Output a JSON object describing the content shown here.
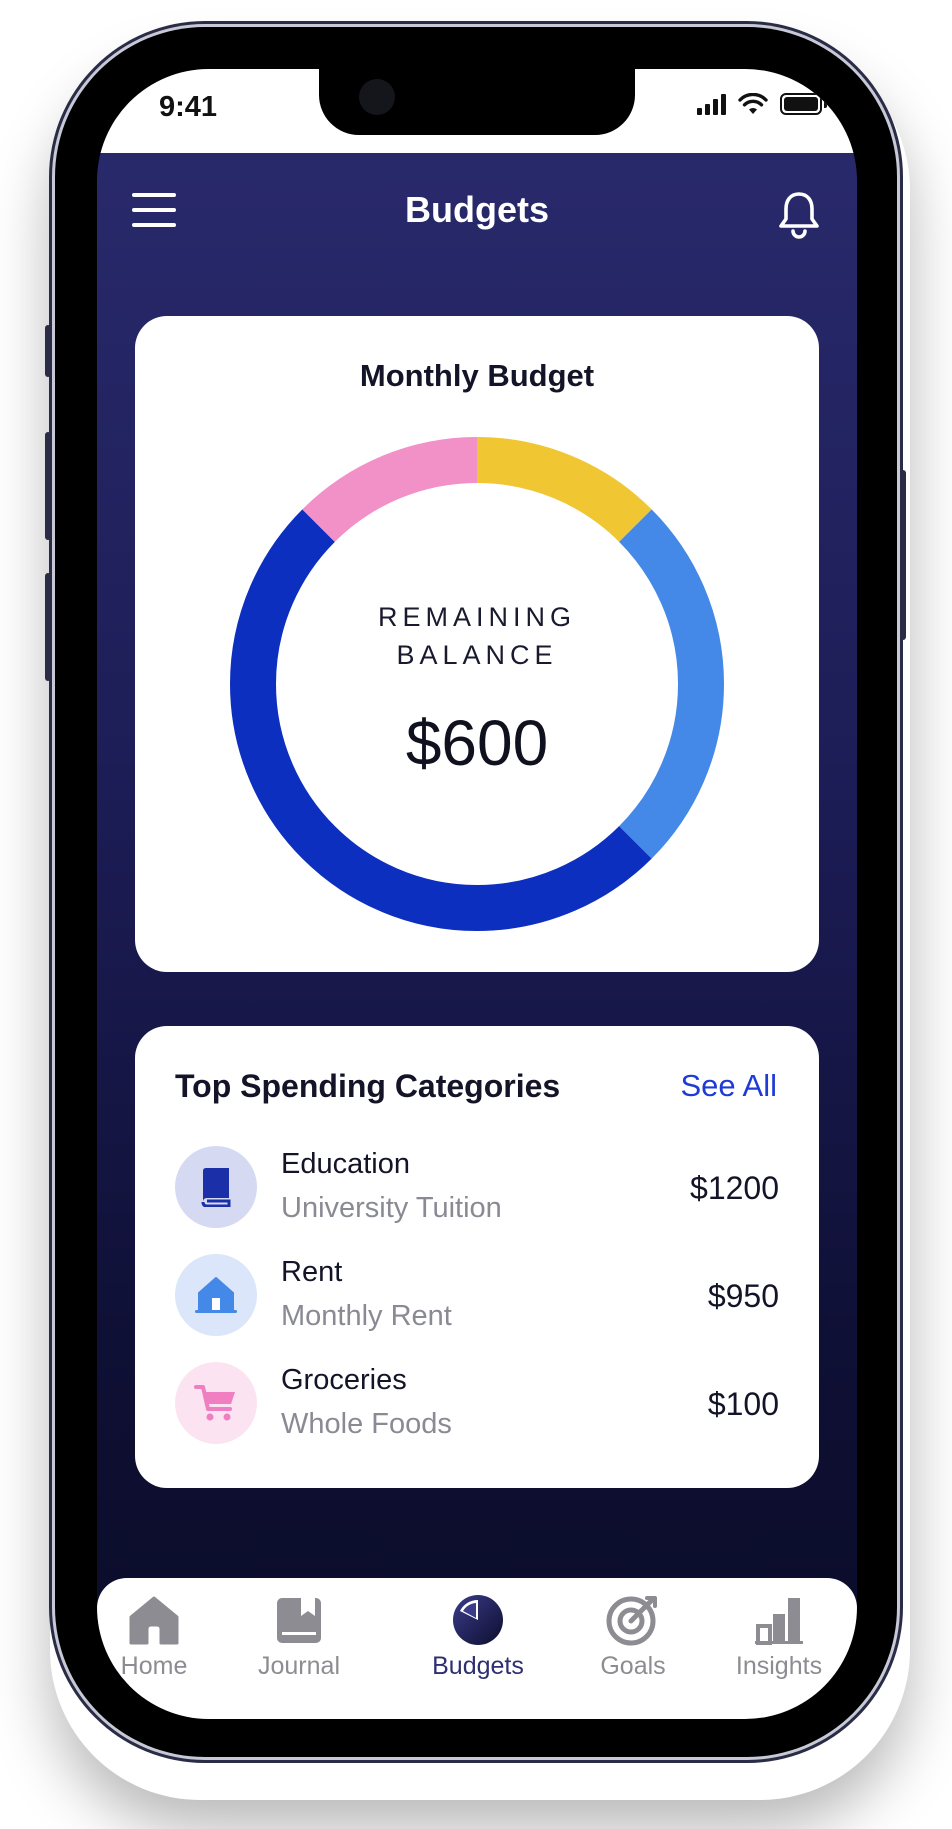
{
  "status_bar": {
    "time": "9:41"
  },
  "header": {
    "title": "Budgets",
    "menu_icon": "hamburger-menu-icon",
    "notification_icon": "bell-icon"
  },
  "budget_card": {
    "title": "Monthly Budget",
    "center_label_line1": "REMAINING",
    "center_label_line2": "BALANCE",
    "remaining_balance": "$600",
    "colors": {
      "education": "#0c2fbf",
      "rent": "#4488e8",
      "groceries": "#f290c8",
      "remaining": "#f0c732"
    }
  },
  "chart_data": {
    "type": "pie",
    "categories": [
      "Remaining",
      "Rent",
      "Education",
      "Groceries"
    ],
    "values": [
      0.125,
      0.25,
      0.5,
      0.125
    ]
  },
  "spending": {
    "title": "Top Spending Categories",
    "see_all": "See All",
    "items": [
      {
        "name": "Education",
        "subtitle": "University Tuition",
        "amount": "$1200",
        "icon": "book-icon",
        "icon_bg": "#d5daf2",
        "icon_color": "#1a2fa8"
      },
      {
        "name": "Rent",
        "subtitle": "Monthly Rent",
        "amount": "$950",
        "icon": "house-icon",
        "icon_bg": "#dbe6fa",
        "icon_color": "#4488e8"
      },
      {
        "name": "Groceries",
        "subtitle": "Whole Foods",
        "amount": "$100",
        "icon": "shopping-cart-icon",
        "icon_bg": "#fbe3f1",
        "icon_color": "#ef7fc0"
      }
    ]
  },
  "tabs": [
    {
      "label": "Home",
      "icon": "home-icon",
      "active": false
    },
    {
      "label": "Journal",
      "icon": "journal-icon",
      "active": false
    },
    {
      "label": "Budgets",
      "icon": "pie-chart-icon",
      "active": true
    },
    {
      "label": "Goals",
      "icon": "target-icon",
      "active": false
    },
    {
      "label": "Insights",
      "icon": "bar-chart-icon",
      "active": false
    }
  ]
}
